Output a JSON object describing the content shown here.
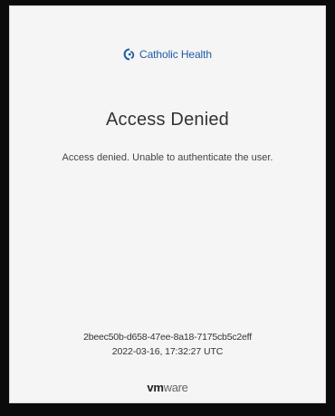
{
  "brand": {
    "name": "Catholic Health",
    "color": "#1f5aa6",
    "icon": "catholic-health-logo-icon"
  },
  "page": {
    "title": "Access Denied",
    "message": "Access denied. Unable to authenticate the user."
  },
  "footer": {
    "session_id": "2beec50b-d658-47ee-8a18-7175cb5c2eff",
    "timestamp": "2022-03-16, 17:32:27 UTC",
    "vendor_logo_vm": "vm",
    "vendor_logo_ware": "ware"
  }
}
